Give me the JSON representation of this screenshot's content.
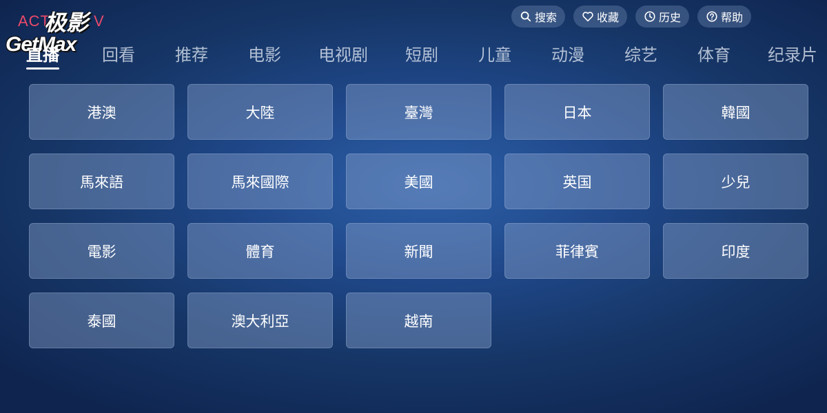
{
  "logo": {
    "brand_text": "ACT",
    "brand_suffix": "V",
    "cn": "极影",
    "en": "GetMax"
  },
  "top_actions": [
    {
      "label": "搜索",
      "icon": "search-icon"
    },
    {
      "label": "收藏",
      "icon": "heart-icon"
    },
    {
      "label": "历史",
      "icon": "clock-icon"
    },
    {
      "label": "帮助",
      "icon": "help-icon"
    }
  ],
  "tabs": [
    {
      "label": "直播",
      "active": true
    },
    {
      "label": "回看"
    },
    {
      "label": "推荐"
    },
    {
      "label": "电影"
    },
    {
      "label": "电视剧"
    },
    {
      "label": "短剧"
    },
    {
      "label": "儿童"
    },
    {
      "label": "动漫"
    },
    {
      "label": "综艺"
    },
    {
      "label": "体育"
    },
    {
      "label": "纪录片"
    }
  ],
  "channels": [
    "港澳",
    "大陸",
    "臺灣",
    "日本",
    "韓國",
    "馬來語",
    "馬來國際",
    "美國",
    "英国",
    "少兒",
    "電影",
    "體育",
    "新聞",
    "菲律賓",
    "印度",
    "泰國",
    "澳大利亞",
    "越南"
  ]
}
